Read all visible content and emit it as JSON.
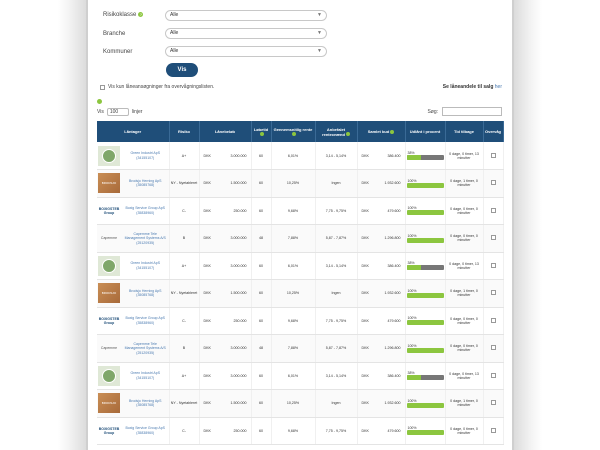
{
  "filters": [
    {
      "label": "Risikoklasse",
      "value": "Alle",
      "has_help": true
    },
    {
      "label": "Branche",
      "value": "Alle",
      "has_help": false
    },
    {
      "label": "Kommuner",
      "value": "Alle",
      "has_help": false
    }
  ],
  "vis_button": "Vis",
  "only_unwatched_label": "Vis kun låneansøgninger fra overvågningslisten.",
  "lease_link": {
    "text": "Se låneandele til salg",
    "link": "her"
  },
  "table_controls": {
    "show_label": "Vis",
    "page_size": "100",
    "rows_label": "linjer",
    "search_label": "Søg:"
  },
  "columns": [
    "Låntager",
    "Risiko",
    "Lånebeløb",
    "Løbetid",
    "Gennemsnitlig rente",
    "Anbefalet renteспænd",
    "Samlet bud",
    "Udlånt i procent",
    "Tid tilbage",
    "Overvåg"
  ],
  "rows": [
    {
      "logo": "green",
      "lessee": "Green Industri ApS (34155107)",
      "risk": "A+",
      "currency": "DKK",
      "amount": "3.000.000",
      "term": "60",
      "avg_rate": "6,01%",
      "recommended": "3,14 - 5,14%",
      "bid_currency": "DKK",
      "total_bid": "386.400",
      "percent": 38,
      "percent_label": "38%",
      "time_left": "0 dage, 0 timer, 13 minutter"
    },
    {
      "logo": "wood",
      "lessee": "Brodsjo Herning ApS (35085768)",
      "risk": "NY - Nyetableret",
      "currency": "DKK",
      "amount": "1.500.000",
      "term": "60",
      "avg_rate": "10,25%",
      "recommended": "Ingen",
      "bid_currency": "DKK",
      "total_bid": "1.932.600",
      "percent": 100,
      "percent_label": "100%",
      "time_left": "0 dage, 1 timer, 0 minutter"
    },
    {
      "logo": "text",
      "lessee": "Boxig Service Group ApS (35838960)",
      "risk": "C-",
      "currency": "DKK",
      "amount": "250.000",
      "term": "60",
      "avg_rate": "9,68%",
      "recommended": "7,75 - 9,75%",
      "bid_currency": "DKK",
      "total_bid": "479.600",
      "percent": 100,
      "percent_label": "100%",
      "time_left": "0 dage, 0 timer, 0 minutter"
    },
    {
      "logo": "cap",
      "lessee": "Capemme Tele Management Systems A/S (25120935)",
      "risk": "B",
      "currency": "DKK",
      "amount": "3.000.000",
      "term": "48",
      "avg_rate": "7,88%",
      "recommended": "5,87 - 7,87%",
      "bid_currency": "DKK",
      "total_bid": "1.296.800",
      "percent": 100,
      "percent_label": "100%",
      "time_left": "0 dage, 0 timer, 0 minutter"
    },
    {
      "logo": "green",
      "lessee": "Green Industri ApS (34155107)",
      "risk": "A+",
      "currency": "DKK",
      "amount": "3.000.000",
      "term": "60",
      "avg_rate": "6,01%",
      "recommended": "3,14 - 5,14%",
      "bid_currency": "DKK",
      "total_bid": "386.400",
      "percent": 38,
      "percent_label": "38%",
      "time_left": "0 dage, 0 timer, 13 minutter"
    },
    {
      "logo": "wood",
      "lessee": "Brodsjo Herning ApS (35085768)",
      "risk": "NY - Nyetableret",
      "currency": "DKK",
      "amount": "1.500.000",
      "term": "60",
      "avg_rate": "10,25%",
      "recommended": "Ingen",
      "bid_currency": "DKK",
      "total_bid": "1.932.600",
      "percent": 100,
      "percent_label": "100%",
      "time_left": "0 dage, 1 timer, 0 minutter"
    },
    {
      "logo": "text",
      "lessee": "Boxig Service Group ApS (35838960)",
      "risk": "C-",
      "currency": "DKK",
      "amount": "250.000",
      "term": "60",
      "avg_rate": "9,68%",
      "recommended": "7,75 - 9,75%",
      "bid_currency": "DKK",
      "total_bid": "479.600",
      "percent": 100,
      "percent_label": "100%",
      "time_left": "0 dage, 0 timer, 0 minutter"
    },
    {
      "logo": "cap",
      "lessee": "Capemme Tele Management Systems A/S (25120935)",
      "risk": "B",
      "currency": "DKK",
      "amount": "3.000.000",
      "term": "48",
      "avg_rate": "7,88%",
      "recommended": "5,87 - 7,87%",
      "bid_currency": "DKK",
      "total_bid": "1.296.800",
      "percent": 100,
      "percent_label": "100%",
      "time_left": "0 dage, 0 timer, 0 minutter"
    },
    {
      "logo": "green",
      "lessee": "Green Industri ApS (34155107)",
      "risk": "A+",
      "currency": "DKK",
      "amount": "3.000.000",
      "term": "60",
      "avg_rate": "6,01%",
      "recommended": "3,14 - 5,14%",
      "bid_currency": "DKK",
      "total_bid": "386.400",
      "percent": 38,
      "percent_label": "38%",
      "time_left": "0 dage, 0 timer, 13 minutter"
    },
    {
      "logo": "wood",
      "lessee": "Brodsjo Herning ApS (35085768)",
      "risk": "NY - Nyetableret",
      "currency": "DKK",
      "amount": "1.500.000",
      "term": "60",
      "avg_rate": "10,25%",
      "recommended": "Ingen",
      "bid_currency": "DKK",
      "total_bid": "1.932.600",
      "percent": 100,
      "percent_label": "100%",
      "time_left": "0 dage, 1 timer, 0 minutter"
    },
    {
      "logo": "text",
      "lessee": "Boxig Service Group ApS (35838960)",
      "risk": "C-",
      "currency": "DKK",
      "amount": "250.000",
      "term": "60",
      "avg_rate": "9,68%",
      "recommended": "7,75 - 9,75%",
      "bid_currency": "DKK",
      "total_bid": "479.600",
      "percent": 100,
      "percent_label": "100%",
      "time_left": "0 dage, 0 timer, 0 minutter"
    }
  ],
  "logo_text": {
    "wood": "BRODSJO",
    "text": "BOXIGSTEB Group",
    "cap": "Capemme"
  },
  "colors": {
    "header": "#1f4e79",
    "accent": "#8cc63f",
    "link": "#4a7ab0"
  }
}
